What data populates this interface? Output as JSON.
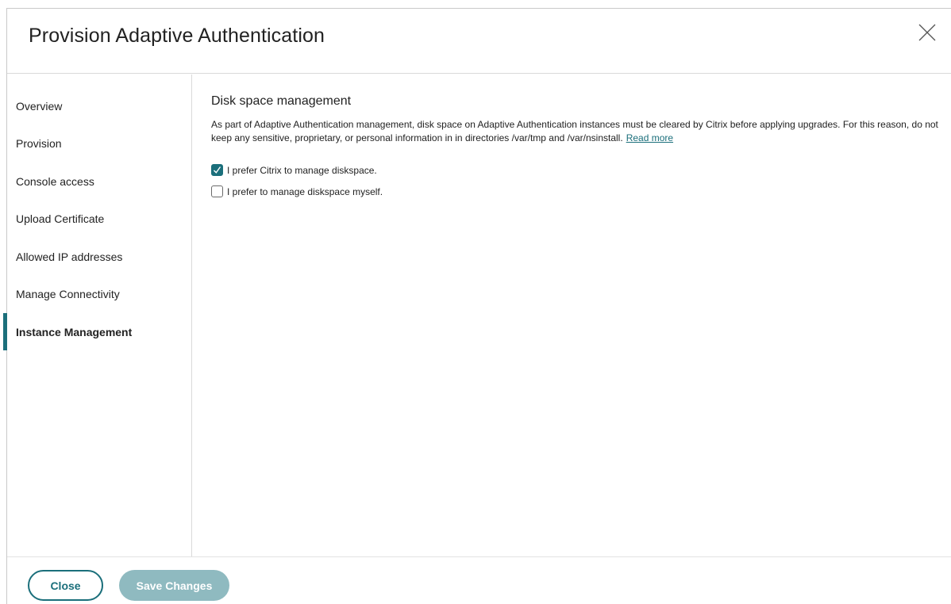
{
  "dialog": {
    "title": "Provision Adaptive Authentication"
  },
  "sidebar": {
    "items": [
      {
        "label": "Overview",
        "active": false
      },
      {
        "label": "Provision",
        "active": false
      },
      {
        "label": "Console access",
        "active": false
      },
      {
        "label": "Upload Certificate",
        "active": false
      },
      {
        "label": "Allowed IP addresses",
        "active": false
      },
      {
        "label": "Manage Connectivity",
        "active": false
      },
      {
        "label": "Instance Management",
        "active": true
      }
    ]
  },
  "main": {
    "section_title": "Disk space management",
    "description": "As part of Adaptive Authentication management, disk space on Adaptive Authentication instances must be cleared by Citrix before applying upgrades. For this reason, do not keep any sensitive, proprietary, or personal information in in directories /var/tmp and /var/nsinstall.",
    "read_more": "Read more",
    "options": [
      {
        "label": "I prefer Citrix to manage diskspace.",
        "checked": true
      },
      {
        "label": "I prefer to manage diskspace myself.",
        "checked": false
      }
    ]
  },
  "footer": {
    "close_label": "Close",
    "save_label": "Save Changes"
  },
  "colors": {
    "accent": "#1b6f7b",
    "disabled_button": "#8fbac0"
  },
  "icons": {
    "close": "close-icon",
    "check": "checkmark-icon"
  }
}
